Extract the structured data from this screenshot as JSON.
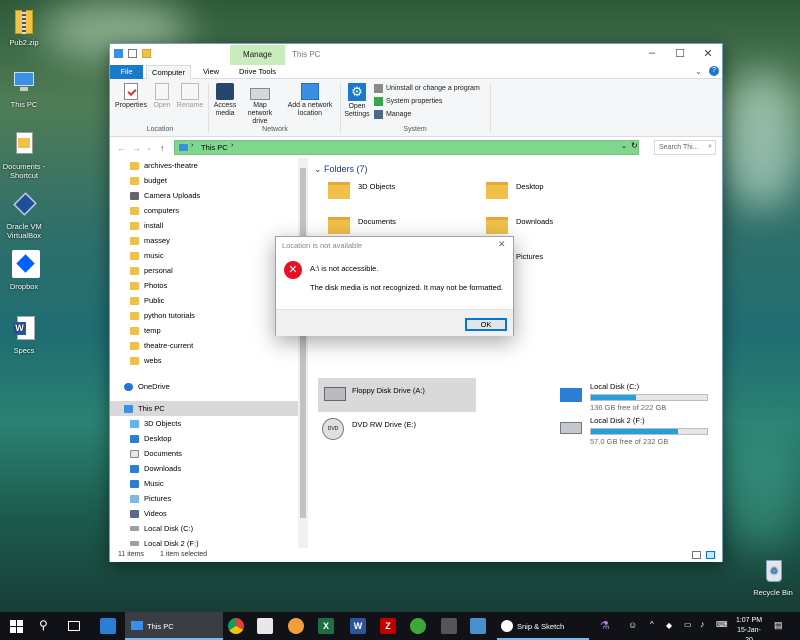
{
  "desktop": {
    "icons": [
      {
        "label": "Pub2.zip"
      },
      {
        "label": "This PC"
      },
      {
        "label": "Documents - Shortcut"
      },
      {
        "label": "Oracle VM VirtualBox"
      },
      {
        "label": "Dropbox"
      },
      {
        "label": "Specs"
      },
      {
        "label": "Recycle Bin"
      }
    ]
  },
  "window": {
    "title": "This PC",
    "contextual_tab": "Manage",
    "tabs": [
      "File",
      "Computer",
      "View",
      "Drive Tools"
    ],
    "ribbon": {
      "location": {
        "label": "Location",
        "buttons": [
          "Properties",
          "Open",
          "Rename"
        ]
      },
      "network": {
        "label": "Network",
        "buttons": [
          "Access media",
          "Map network drive",
          "Add a network location"
        ]
      },
      "system": {
        "label": "System",
        "open_settings": "Open Settings",
        "items": [
          "Uninstall or change a program",
          "System properties",
          "Manage"
        ]
      }
    },
    "address": {
      "path": "This PC",
      "search_placeholder": "Search Thi..."
    },
    "nav": {
      "folders": [
        "archives-theatre",
        "budget",
        "Camera Uploads",
        "computers",
        "install",
        "massey",
        "music",
        "personal",
        "Photos",
        "Public",
        "python tutorials",
        "temp",
        "theatre-current",
        "webs"
      ],
      "onedrive": "OneDrive",
      "thispc": "This PC",
      "thispc_items": [
        "3D Objects",
        "Desktop",
        "Documents",
        "Downloads",
        "Music",
        "Pictures",
        "Videos",
        "Local Disk (C:)",
        "Local Disk 2 (F:)"
      ]
    },
    "content": {
      "folders_header": "Folders (7)",
      "folders": [
        "3D Objects",
        "Desktop",
        "Documents",
        "Downloads",
        "Pictures"
      ],
      "drives": [
        {
          "name": "Floppy Disk Drive (A:)"
        },
        {
          "name": "Local Disk (C:)",
          "free": "136 GB free of 222 GB",
          "used_fraction": 0.39
        },
        {
          "name": "DVD RW Drive (E:)"
        },
        {
          "name": "Local Disk 2 (F:)",
          "free": "57.0 GB free of 232 GB",
          "used_fraction": 0.75
        }
      ]
    },
    "status": {
      "items": "11 items",
      "selected": "1 item selected"
    }
  },
  "dialog": {
    "title": "Location is not available",
    "message": "A:\\ is not accessible.",
    "detail": "The disk media is not recognized. It may not be formatted.",
    "ok": "OK"
  },
  "taskbar": {
    "explorer_label": "This PC",
    "snip_label": "Snip & Sketch",
    "time": "1:07 PM",
    "date": "15-Jan-20"
  }
}
